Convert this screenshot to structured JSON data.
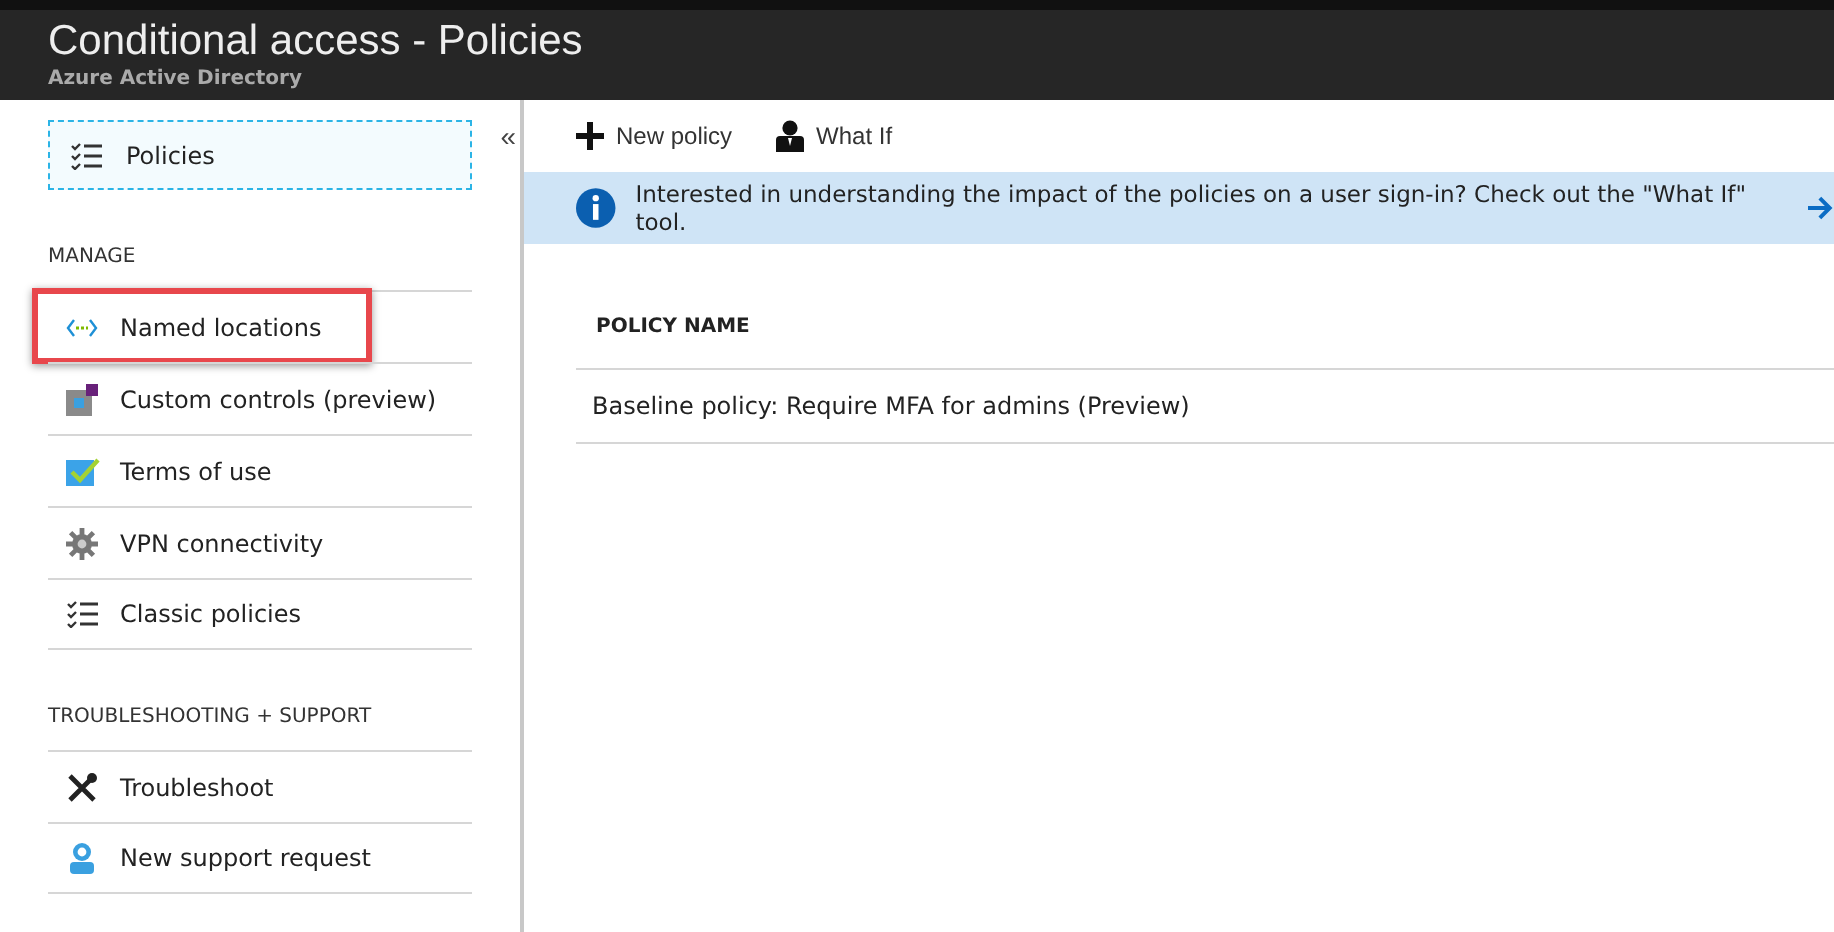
{
  "header": {
    "title": "Conditional access - Policies",
    "subtitle": "Azure Active Directory"
  },
  "sidebar": {
    "collapse": "«",
    "top_item": {
      "label": "Policies",
      "selected": true
    },
    "sections": [
      {
        "heading": "MANAGE",
        "items": [
          {
            "label": "Named locations",
            "highlighted": true
          },
          {
            "label": "Custom controls (preview)",
            "highlighted": false
          },
          {
            "label": "Terms of use",
            "highlighted": false
          },
          {
            "label": "VPN connectivity",
            "highlighted": false
          },
          {
            "label": "Classic policies",
            "highlighted": false
          }
        ]
      },
      {
        "heading": "TROUBLESHOOTING + SUPPORT",
        "items": [
          {
            "label": "Troubleshoot",
            "highlighted": false
          },
          {
            "label": "New support request",
            "highlighted": false
          }
        ]
      }
    ]
  },
  "toolbar": [
    {
      "label": "New policy"
    },
    {
      "label": "What If"
    }
  ],
  "banner": {
    "text": "Interested in understanding the impact of the policies on a user sign-in? Check out the \"What If\" tool."
  },
  "table": {
    "columns": [
      "POLICY NAME"
    ],
    "rows": [
      [
        "Baseline policy: Require MFA for admins (Preview)"
      ]
    ]
  }
}
